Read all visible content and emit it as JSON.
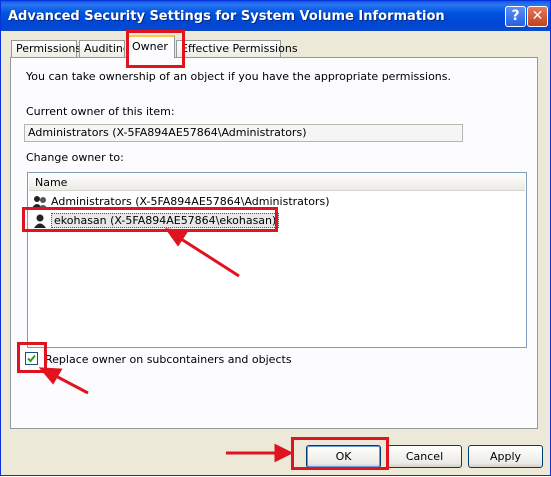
{
  "window": {
    "title": "Advanced Security Settings for System Volume Information",
    "help_glyph": "?",
    "close_glyph": "✕"
  },
  "tabs": [
    {
      "label": "Permissions"
    },
    {
      "label": "Auditing"
    },
    {
      "label": "Owner",
      "active": true
    },
    {
      "label": "Effective Permissions"
    }
  ],
  "owner_tab": {
    "intro": "You can take ownership of an object if you have the appropriate permissions.",
    "current_owner_label": "Current owner of this item:",
    "current_owner_value": "Administrators (X-5FA894AE57864\\Administrators)",
    "change_owner_label": "Change owner to:",
    "list_header": "Name",
    "list_items": [
      {
        "label": "Administrators (X-5FA894AE57864\\Administrators)",
        "icon": "users-group-icon"
      },
      {
        "label": "ekohasan (X-5FA894AE57864\\ekohasan)",
        "icon": "user-icon",
        "selected": true
      }
    ],
    "replace_owner_label": "Replace owner on subcontainers and objects",
    "replace_owner_checked": true
  },
  "buttons": {
    "ok": "OK",
    "cancel": "Cancel",
    "apply": "Apply"
  },
  "annotation_color": "#E0141E"
}
